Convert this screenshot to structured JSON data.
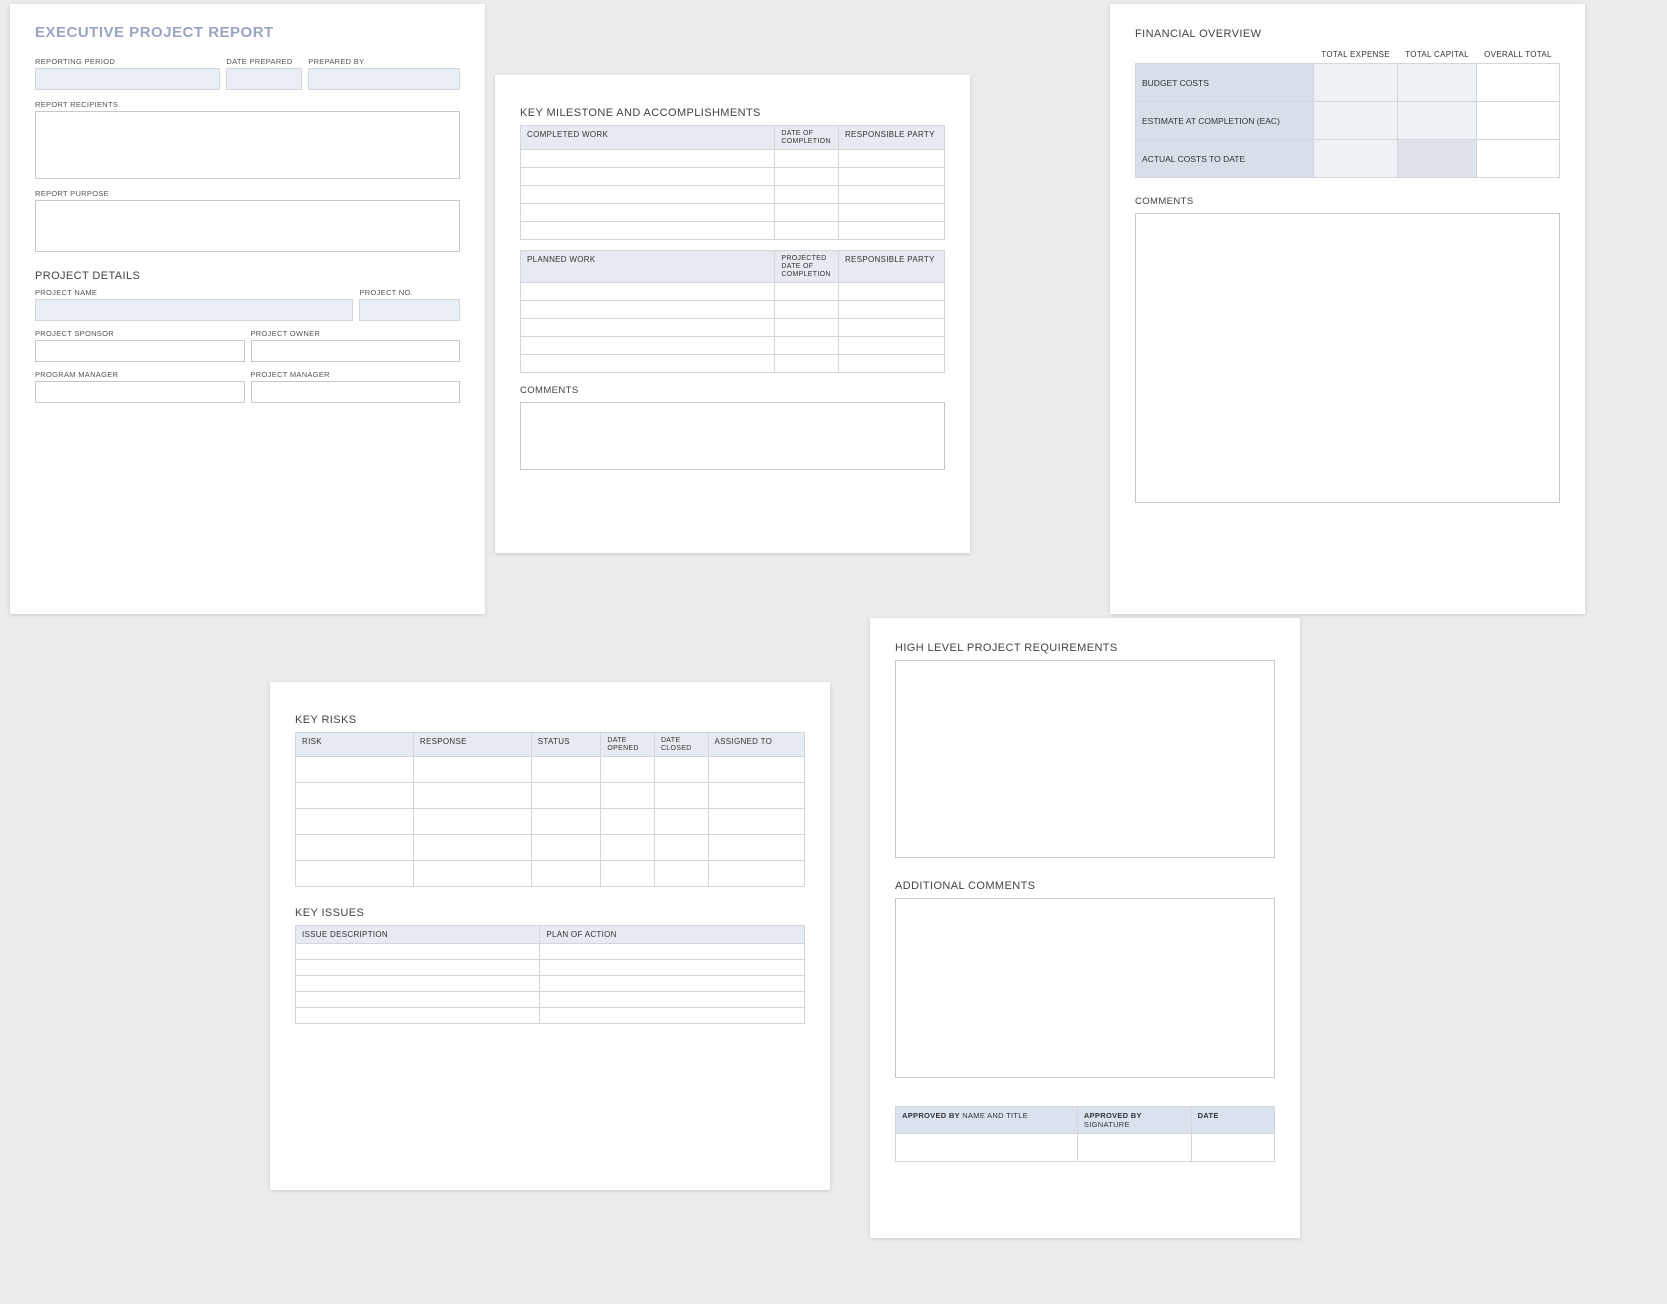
{
  "p1": {
    "title": "EXECUTIVE PROJECT REPORT",
    "labels": {
      "reporting_period": "REPORTING PERIOD",
      "date_prepared": "DATE PREPARED",
      "prepared_by": "PREPARED BY",
      "report_recipients": "REPORT RECIPIENTS",
      "report_purpose": "REPORT PURPOSE",
      "project_details": "PROJECT DETAILS",
      "project_name": "PROJECT NAME",
      "project_no": "PROJECT NO.",
      "project_sponsor": "PROJECT SPONSOR",
      "project_owner": "PROJECT OWNER",
      "program_manager": "PROGRAM MANAGER",
      "project_manager": "PROJECT MANAGER"
    }
  },
  "p2": {
    "title": "KEY MILESTONE AND ACCOMPLISHMENTS",
    "completed": {
      "headers": {
        "work": "COMPLETED WORK",
        "date": "DATE OF COMPLETION",
        "party": "RESPONSIBLE PARTY"
      }
    },
    "planned": {
      "headers": {
        "work": "PLANNED WORK",
        "date": "PROJECTED DATE OF COMPLETION",
        "party": "RESPONSIBLE PARTY"
      }
    },
    "comments_label": "COMMENTS"
  },
  "p3": {
    "title": "FINANCIAL OVERVIEW",
    "headers": {
      "expense": "TOTAL EXPENSE",
      "capital": "TOTAL CAPITAL",
      "overall": "OVERALL TOTAL"
    },
    "rows": {
      "budget": "BUDGET COSTS",
      "eac": "ESTIMATE AT COMPLETION (EAC)",
      "actual": "ACTUAL COSTS TO DATE"
    },
    "comments_label": "COMMENTS"
  },
  "p4": {
    "key_risks_title": "KEY RISKS",
    "risks_headers": {
      "risk": "RISK",
      "response": "RESPONSE",
      "status": "STATUS",
      "opened": "DATE OPENED",
      "closed": "DATE CLOSED",
      "assigned": "ASSIGNED TO"
    },
    "key_issues_title": "KEY ISSUES",
    "issues_headers": {
      "desc": "ISSUE DESCRIPTION",
      "plan": "PLAN OF ACTION"
    }
  },
  "p5": {
    "requirements_title": "HIGH LEVEL PROJECT REQUIREMENTS",
    "additional_comments_title": "ADDITIONAL COMMENTS",
    "approval": {
      "name": "APPROVED BY NAME AND TITLE",
      "name_bold": "APPROVED BY",
      "name_rest": " NAME AND TITLE",
      "sig_bold": "APPROVED BY",
      "sig_rest": " SIGNATURE",
      "date": "DATE"
    }
  }
}
